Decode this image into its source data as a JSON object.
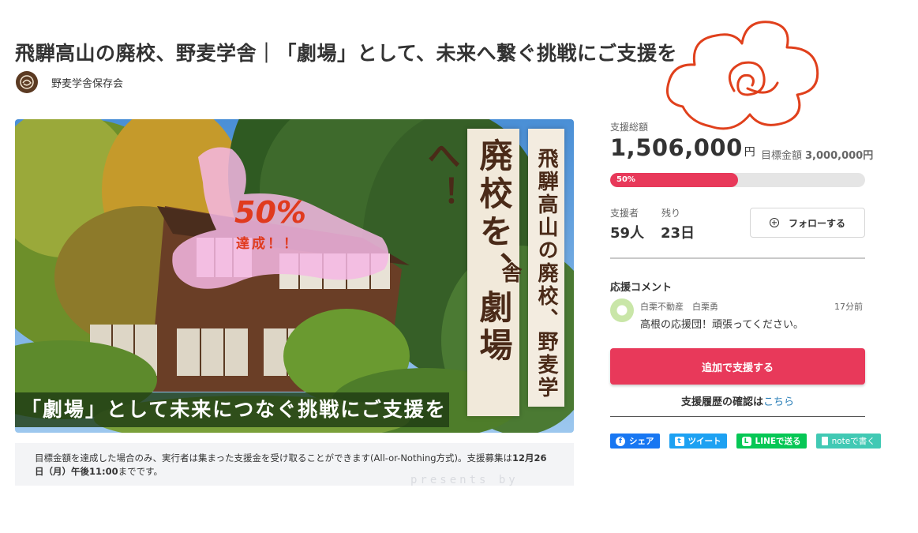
{
  "page": {
    "title": "飛騨高山の廃校、野麦学舎｜「劇場」として、未来へ繋ぐ挑戦にご支援を",
    "org_name": "野麦学舎保存会"
  },
  "hero": {
    "vertical_small": "飛騨高山の廃校、野麦学舎",
    "vertical_big": "廃校を、劇場へ！",
    "badge_percent": "50%",
    "badge_text": "達成！！",
    "bottom_banner": "「劇場」として未来につなぐ挑戦にご支援を"
  },
  "notice": {
    "text": "目標金額を達成した場合のみ、実行者は集まった支援金を受け取ることができます(All-or-Nothing方式)。支援募集は",
    "deadline": "12月26日（月）午後11:00",
    "suffix": "までです。",
    "watermark": "presents by"
  },
  "funding": {
    "total_label": "支援総額",
    "total_amount": "1,506,000",
    "currency": "円",
    "goal_label": "目標金額",
    "goal_amount": "3,000,000円",
    "progress_percent": 50,
    "progress_label": "50%",
    "backers_label": "支援者",
    "backers_value": "59人",
    "remaining_label": "残り",
    "remaining_value": "23日",
    "follow_label": "フォローする"
  },
  "comments": {
    "title": "応援コメント",
    "items": [
      {
        "author": "白栗不動産　白栗勇",
        "time": "17分前",
        "text": "高根の応援団！頑張ってください。"
      }
    ]
  },
  "actions": {
    "support_label": "追加で支援する",
    "history_text": "支援履歴の確認は",
    "history_link": "こちら"
  },
  "share": {
    "facebook": "シェア",
    "twitter": "ツイート",
    "line": "LINEで送る",
    "note": "noteで書く"
  },
  "colors": {
    "accent": "#e8395a",
    "facebook": "#1877f2",
    "twitter": "#1da1f2",
    "line": "#06c755",
    "note": "#41c9b4",
    "scribble": "#e0401c"
  }
}
